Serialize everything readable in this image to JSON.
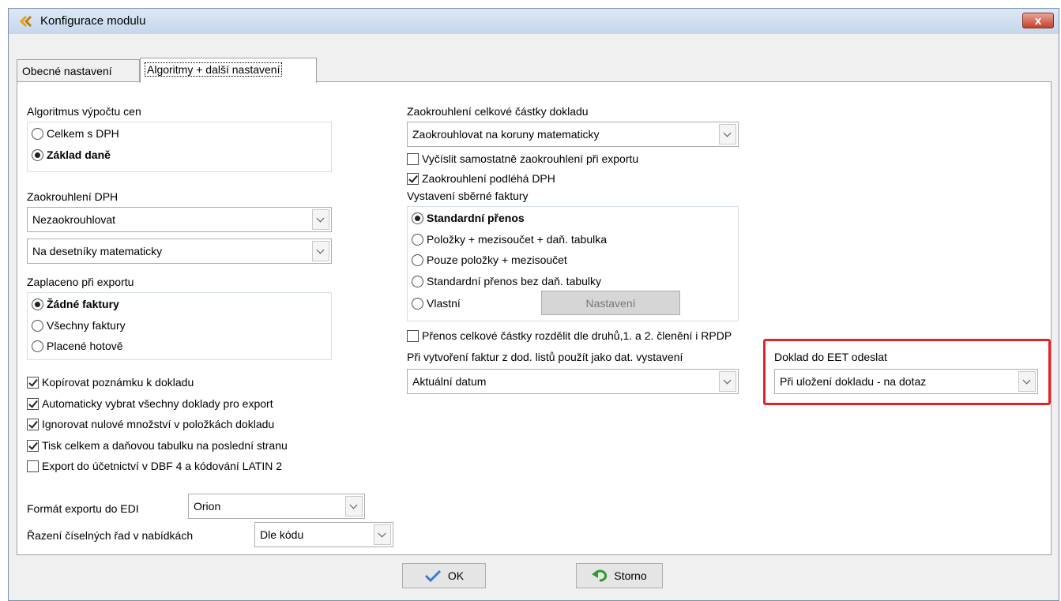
{
  "window": {
    "title": "Konfigurace modulu",
    "close_label": "x"
  },
  "tabs": [
    {
      "label": "Obecné nastavení"
    },
    {
      "label": "Algoritmy + další nastavení"
    }
  ],
  "price_algorithm": {
    "label": "Algoritmus výpočtu cen",
    "options": [
      "Celkem s DPH",
      "Základ daně"
    ],
    "selected": "Základ daně"
  },
  "vat_rounding": {
    "label": "Zaokrouhlení DPH",
    "combo1": "Nezaokrouhlovat",
    "combo2": "Na desetníky matematicky"
  },
  "paid_on_export": {
    "label": "Zaplaceno při exportu",
    "options": [
      "Žádné faktury",
      "Všechny faktury",
      "Placené hotově"
    ],
    "selected": "Žádné faktury"
  },
  "checkboxes_left": [
    {
      "label": "Kopírovat poznámku k dokladu",
      "checked": true
    },
    {
      "label": "Automaticky vybrat všechny doklady pro export",
      "checked": true
    },
    {
      "label": "Ignorovat nulové množství v položkách dokladu",
      "checked": true
    },
    {
      "label": "Tisk celkem a daňovou tabulku na poslední stranu",
      "checked": true
    },
    {
      "label": "Export do účetnictví v DBF 4 a kódování LATIN 2",
      "checked": false
    }
  ],
  "edi_format": {
    "label": "Formát exportu do EDI",
    "value": "Orion"
  },
  "series_order": {
    "label": "Řazení číselných řad v nabídkách",
    "value": "Dle kódu"
  },
  "total_rounding": {
    "label": "Zaokrouhlení celkové částky dokladu",
    "value": "Zaokrouhlovat na koruny matematicky"
  },
  "checkboxes_right": [
    {
      "label": "Vyčíslit samostatně zaokrouhlení při exportu",
      "checked": false
    },
    {
      "label": "Zaokrouhlení podléhá DPH",
      "checked": true
    }
  ],
  "collective_invoice": {
    "label": "Vystavení sběrné faktury",
    "options": [
      "Standardní přenos",
      "Položky + mezisoučet + daň. tabulka",
      "Pouze položky + mezisoučet",
      "Standardní přenos bez daň. tabulky",
      "Vlastní"
    ],
    "selected": "Standardní přenos",
    "settings_button": "Nastavení"
  },
  "split_transfer": {
    "label": "Přenos celkové částky rozdělit dle druhů,1. a 2. členění i RPDP",
    "checked": false
  },
  "delivery_date": {
    "label": "Při vytvoření faktur z dod. listů použít jako dat. vystavení",
    "value": "Aktuální datum"
  },
  "eet": {
    "label": "Doklad do EET odeslat",
    "value": "Při uložení dokladu - na dotaz",
    "highlight_color": "#e0252a"
  },
  "footer": {
    "ok_label": "OK",
    "cancel_label": "Storno"
  }
}
